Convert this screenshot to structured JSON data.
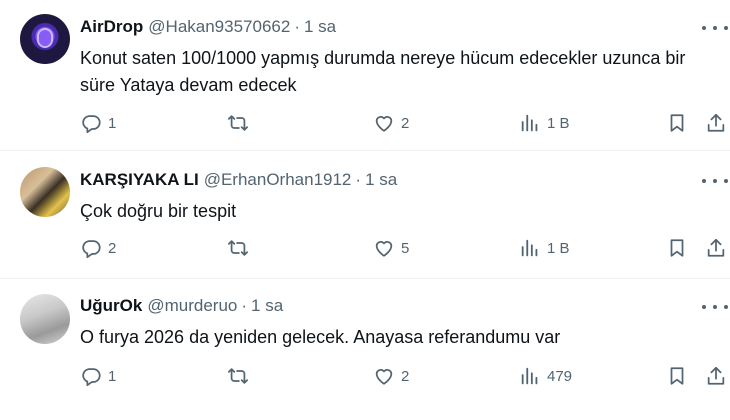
{
  "tweets": [
    {
      "name": "AirDrop",
      "handle": "@Hakan93570662",
      "separator": "·",
      "time": "1 sa",
      "text": "Konut saten 100/1000 yapmış durumda nereye hücum edecekler uzunca bir süre Yataya devam edecek",
      "replies": "1",
      "reposts": "",
      "likes": "2",
      "views": "1 B"
    },
    {
      "name": "KARŞIYAKA LI",
      "handle": "@ErhanOrhan1912",
      "separator": "·",
      "time": "1 sa",
      "text": "Çok doğru bir tespit",
      "replies": "2",
      "reposts": "",
      "likes": "5",
      "views": "1 B"
    },
    {
      "name": "UğurOk",
      "handle": "@murderuo",
      "separator": "·",
      "time": "1 sa",
      "text": "O furya 2026 da yeniden gelecek. Anayasa referandumu var",
      "replies": "1",
      "reposts": "",
      "likes": "2",
      "views": "479"
    }
  ],
  "icons": {
    "reply": "reply-icon",
    "repost": "repost-icon",
    "like": "like-icon",
    "views": "views-icon",
    "bookmark": "bookmark-icon",
    "share": "share-icon",
    "more": "more-icon"
  },
  "colors": {
    "text": "#0f1419",
    "secondary": "#536471",
    "divider": "#eff3f4"
  }
}
